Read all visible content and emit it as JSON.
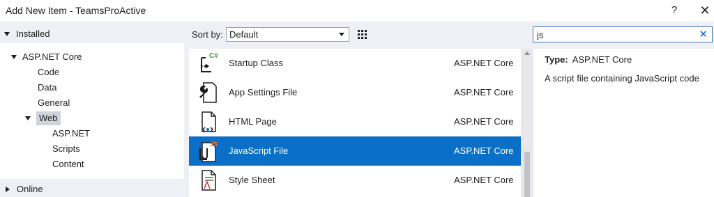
{
  "window": {
    "title": "Add New Item - TeamsProActive",
    "help_label": "?",
    "close_label": "✕"
  },
  "left": {
    "installed_label": "Installed",
    "tree": [
      {
        "label": "ASP.NET Core"
      },
      {
        "label": "Code"
      },
      {
        "label": "Data"
      },
      {
        "label": "General"
      },
      {
        "label": "Web"
      },
      {
        "label": "ASP.NET"
      },
      {
        "label": "Scripts"
      },
      {
        "label": "Content"
      }
    ],
    "online_label": "Online"
  },
  "toolbar": {
    "sort_label": "Sort by:",
    "sort_value": "Default"
  },
  "search": {
    "value": "js",
    "clear_label": "✕"
  },
  "items": [
    {
      "name": "Startup Class",
      "category": "ASP.NET Core",
      "icon": "csharp-class-icon"
    },
    {
      "name": "App Settings File",
      "category": "ASP.NET Core",
      "icon": "settings-file-icon"
    },
    {
      "name": "HTML Page",
      "category": "ASP.NET Core",
      "icon": "html-file-icon"
    },
    {
      "name": "JavaScript File",
      "category": "ASP.NET Core",
      "icon": "javascript-file-icon",
      "selected": true
    },
    {
      "name": "Style Sheet",
      "category": "ASP.NET Core",
      "icon": "stylesheet-file-icon"
    }
  ],
  "details": {
    "type_key": "Type:",
    "type_value": "ASP.NET Core",
    "description": "A script file containing JavaScript code"
  },
  "colors": {
    "selection": "#0a6fc7",
    "accent": "#3b78c4",
    "js_badge": "#e8772e",
    "csharp_badge": "#3a9a3a"
  }
}
